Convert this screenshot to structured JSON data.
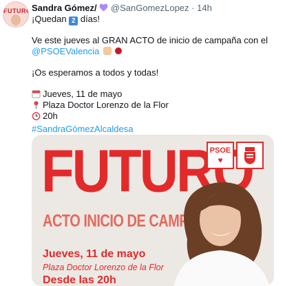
{
  "tweet": {
    "author_name": "Sandra Gómez/",
    "handle": "@SanGomezLopez",
    "separator": "·",
    "time": "14h",
    "line1_prefix": "¡Quedan",
    "line1_number": "2",
    "line1_suffix": "días!",
    "line2": "Ve este jueves al GRAN ACTO de inicio de campaña con el",
    "mention": "@PSOEValencia",
    "line3": "¡Os esperamos a todos y todas!",
    "date_line": "Jueves, 11 de mayo",
    "place_line": "Plaza Doctor Lorenzo de la Flor",
    "time_line": "20h",
    "hashtag": "#SandraGómezAlcaldesa"
  },
  "avatar": {
    "text": "FUTURO"
  },
  "poster": {
    "headline": "FUTURO",
    "subtitle": "ACTO INICIO DE CAMPAÑA",
    "date": "Jueves, 11 de mayo",
    "place": "Plaza Doctor Lorenzo de la Flor",
    "time_partial": "Desde las 20h",
    "logo_text": "PSOE",
    "logo_heart": "♥"
  },
  "colors": {
    "link": "#1d9bf0",
    "accent_red": "#e22a2a",
    "muted": "#536471",
    "heart": "#a78bfa"
  },
  "icons": [
    "calendar-icon",
    "pin-icon",
    "clock-icon",
    "heart-icon",
    "clapping-hands-icon",
    "rose-icon"
  ]
}
